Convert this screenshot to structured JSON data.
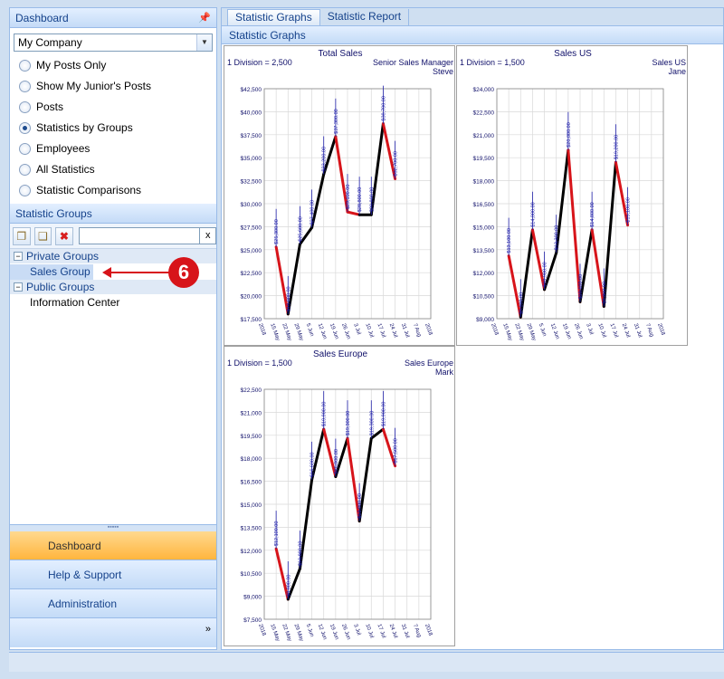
{
  "dashboard": {
    "header": "Dashboard",
    "pin": "\u0000",
    "company": "My Company",
    "options": [
      {
        "label": "My Posts Only",
        "selected": false
      },
      {
        "label": "Show My Junior's Posts",
        "selected": false
      },
      {
        "label": "Posts",
        "selected": false
      },
      {
        "label": "Statistics by Groups",
        "selected": true
      },
      {
        "label": "Employees",
        "selected": false
      },
      {
        "label": "All Statistics",
        "selected": false
      },
      {
        "label": "Statistic Comparisons",
        "selected": false
      }
    ]
  },
  "statistic_groups": {
    "header": "Statistic Groups",
    "clear_label": "x",
    "private_group": "Private Groups",
    "private_items": [
      "Sales Group"
    ],
    "public_group": "Public Groups",
    "public_items": [
      "Information Center"
    ],
    "callout": "6"
  },
  "nav": {
    "items": [
      "Dashboard",
      "Help & Support",
      "Administration"
    ],
    "active": "Dashboard",
    "more": "»"
  },
  "tabs": [
    "Statistic Graphs",
    "Statistic Report"
  ],
  "subheader": "Statistic Graphs",
  "colors": {
    "up": "#000000",
    "down": "#d7141a",
    "label": "#1f1fa8"
  },
  "chart_data": [
    {
      "type": "line",
      "title": "Total Sales",
      "division": "1 Division = 2,500",
      "owner": "Senior Sales Manager",
      "person": "Steve",
      "yticks": [
        "$17,500",
        "$20,000",
        "$22,500",
        "$25,000",
        "$27,500",
        "$30,000",
        "$32,500",
        "$35,000",
        "$37,500",
        "$40,000",
        "$42,500"
      ],
      "ylim": [
        17500,
        42500
      ],
      "xticks": [
        "2018",
        "15 May",
        "22 May",
        "29 May",
        "5 Jun",
        "12 Jun",
        "19 Jun",
        "26 Jun",
        "3 Jul",
        "10 Jul",
        "17 Jul",
        "24 Jul",
        "31 Jul",
        "7 Aug",
        "2018"
      ],
      "x": [
        1,
        2,
        3,
        4,
        5,
        6,
        7,
        8,
        9,
        10,
        11,
        12
      ],
      "values": [
        25300,
        18000,
        25600,
        27400,
        33200,
        37300,
        29100,
        28800,
        28800,
        38700,
        32700
      ],
      "point_labels": [
        "$25,300.00",
        "$18,000.00",
        "$25,600.00",
        "$27,400.00",
        "$33,200.00",
        "$37,300.00",
        "$29,100.00",
        "$28,800.00",
        "$28,800.00",
        "$38,700.00",
        "$32,700.00"
      ]
    },
    {
      "type": "line",
      "title": "Sales US",
      "division": "1 Division = 1,500",
      "owner": "Sales US",
      "person": "Jane",
      "yticks": [
        "$9,000",
        "$10,500",
        "$12,000",
        "$13,500",
        "$15,000",
        "$16,500",
        "$18,000",
        "$19,500",
        "$21,000",
        "$22,500",
        "$24,000"
      ],
      "ylim": [
        9000,
        24000
      ],
      "xticks": [
        "2018",
        "15 May",
        "22 May",
        "29 May",
        "5 Jun",
        "12 Jun",
        "19 Jun",
        "26 Jun",
        "3 Jul",
        "10 Jul",
        "17 Jul",
        "24 Jul",
        "31 Jul",
        "7 Aug",
        "2018"
      ],
      "x": [
        1,
        2,
        3,
        4,
        5,
        6,
        7,
        8,
        9,
        10,
        11,
        12
      ],
      "values": [
        13100,
        9100,
        14800,
        10900,
        13300,
        20000,
        10100,
        14800,
        9800,
        19200,
        15100
      ],
      "point_labels": [
        "$13,100.00",
        "$9,100.00",
        "$14,800.00",
        "$10,900.00",
        "$13,300.00",
        "$20,000.00",
        "$10,100.00",
        "$14,800.00",
        "$9,800.00",
        "$19,200.00",
        "$15,100.00"
      ]
    },
    {
      "type": "line",
      "title": "Sales Europe",
      "division": "1 Division = 1,500",
      "owner": "Sales Europe",
      "person": "Mark",
      "yticks": [
        "$7,500",
        "$9,000",
        "$10,500",
        "$12,000",
        "$13,500",
        "$15,000",
        "$16,500",
        "$18,000",
        "$19,500",
        "$21,000",
        "$22,500"
      ],
      "ylim": [
        7500,
        22500
      ],
      "xticks": [
        "2018",
        "15 May",
        "22 May",
        "29 May",
        "5 Jun",
        "12 Jun",
        "19 Jun",
        "26 Jun",
        "3 Jul",
        "10 Jul",
        "17 Jul",
        "24 Jul",
        "31 Jul",
        "7 Aug",
        "2018"
      ],
      "x": [
        1,
        2,
        3,
        4,
        5,
        6,
        7,
        8,
        9,
        10,
        11,
        12
      ],
      "values": [
        12100,
        8800,
        10800,
        16600,
        19900,
        16800,
        19300,
        13900,
        19300,
        19900,
        17500
      ],
      "point_labels": [
        "$12,100.00",
        "$8,800.00",
        "$10,800.00",
        "$16,600.00",
        "$19,900.00",
        "$16,800.00",
        "$19,300.00",
        "$13,900.00",
        "$19,300.00",
        "$19,900.00",
        "$17,500.00"
      ]
    }
  ]
}
